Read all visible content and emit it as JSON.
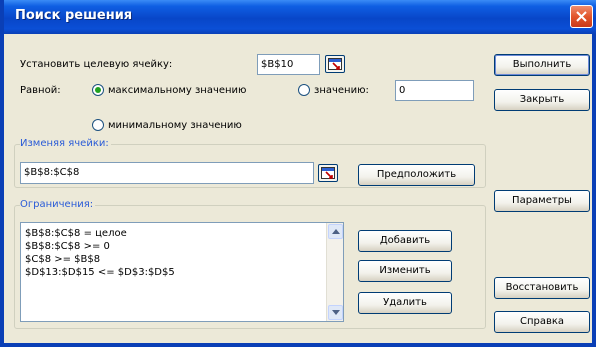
{
  "window": {
    "title": "Поиск решения"
  },
  "target": {
    "label": "Установить целевую ячейку:",
    "value": "$B$10"
  },
  "equal": {
    "label": "Равной:",
    "options": [
      {
        "label": "максимальному значению",
        "selected": true
      },
      {
        "label": "значению:",
        "selected": false
      },
      {
        "label": "минимальному значению",
        "selected": false
      }
    ],
    "value": "0"
  },
  "changing": {
    "label": "Изменяя ячейки:",
    "value": "$B$8:$C$8",
    "guess_label": "Предположить"
  },
  "constraints": {
    "label": "Ограничения:",
    "items": [
      "$B$8:$C$8 = целое",
      "$B$8:$C$8 >= 0",
      "$C$8 >= $B$8",
      "$D$13:$D$15 <= $D$3:$D$5"
    ],
    "add_label": "Добавить",
    "change_label": "Изменить",
    "delete_label": "Удалить"
  },
  "buttons": {
    "solve": "Выполнить",
    "close": "Закрыть",
    "options": "Параметры",
    "reset": "Восстановить",
    "help": "Справка"
  },
  "colors": {
    "titlebar": "#0846c8",
    "dialog_bg": "#ece9d8",
    "accent_label": "#2a5bd7",
    "close_button": "#e2562b"
  }
}
